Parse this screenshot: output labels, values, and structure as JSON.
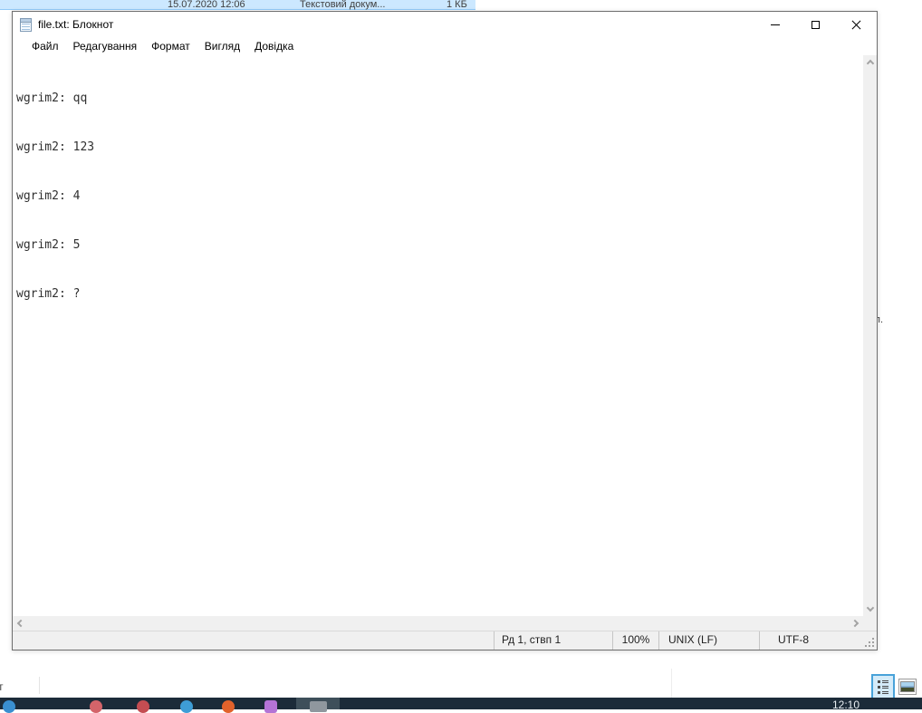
{
  "explorer": {
    "selected_file_row": {
      "date_modified": "15.07.2020 12:06",
      "file_type": "Текстовий докум...",
      "file_size": "1 КБ"
    },
    "background_fragments": {
      "right_text": "п.",
      "bottom_left_text": "т"
    },
    "view_switcher": {
      "details_icon": "details-view-icon",
      "thumbnails_icon": "thumbnails-view-icon"
    }
  },
  "notepad": {
    "window_title": "file.txt: Блокнот",
    "menu": {
      "file": "Файл",
      "edit": "Редагування",
      "format": "Формат",
      "view": "Вигляд",
      "help": "Довідка"
    },
    "content_lines": [
      "wgrim2: qq",
      "wgrim2: 123",
      "wgrim2: 4",
      "wgrim2: 5",
      "wgrim2: ?"
    ],
    "window_controls": {
      "minimize": "minimize-icon",
      "maximize": "maximize-icon",
      "close": "close-icon"
    },
    "status_bar": {
      "cursor_position": "Рд 1, ствп 1",
      "zoom_level": "100%",
      "line_ending": "UNIX (LF)",
      "encoding": "UTF-8"
    }
  },
  "taskbar": {
    "clock": "12:10"
  },
  "colors": {
    "selection_blue": "#cce8ff",
    "selection_border": "#91c9f7",
    "window_border": "#6e6e6e",
    "scrollbar_track": "#f0f0f0",
    "status_bar_bg": "#f0f0f0",
    "taskbar_bg": "#1c2b39",
    "taskbar_active_bg": "#3e4f5a",
    "view_details_accent": "#48a2d9"
  }
}
